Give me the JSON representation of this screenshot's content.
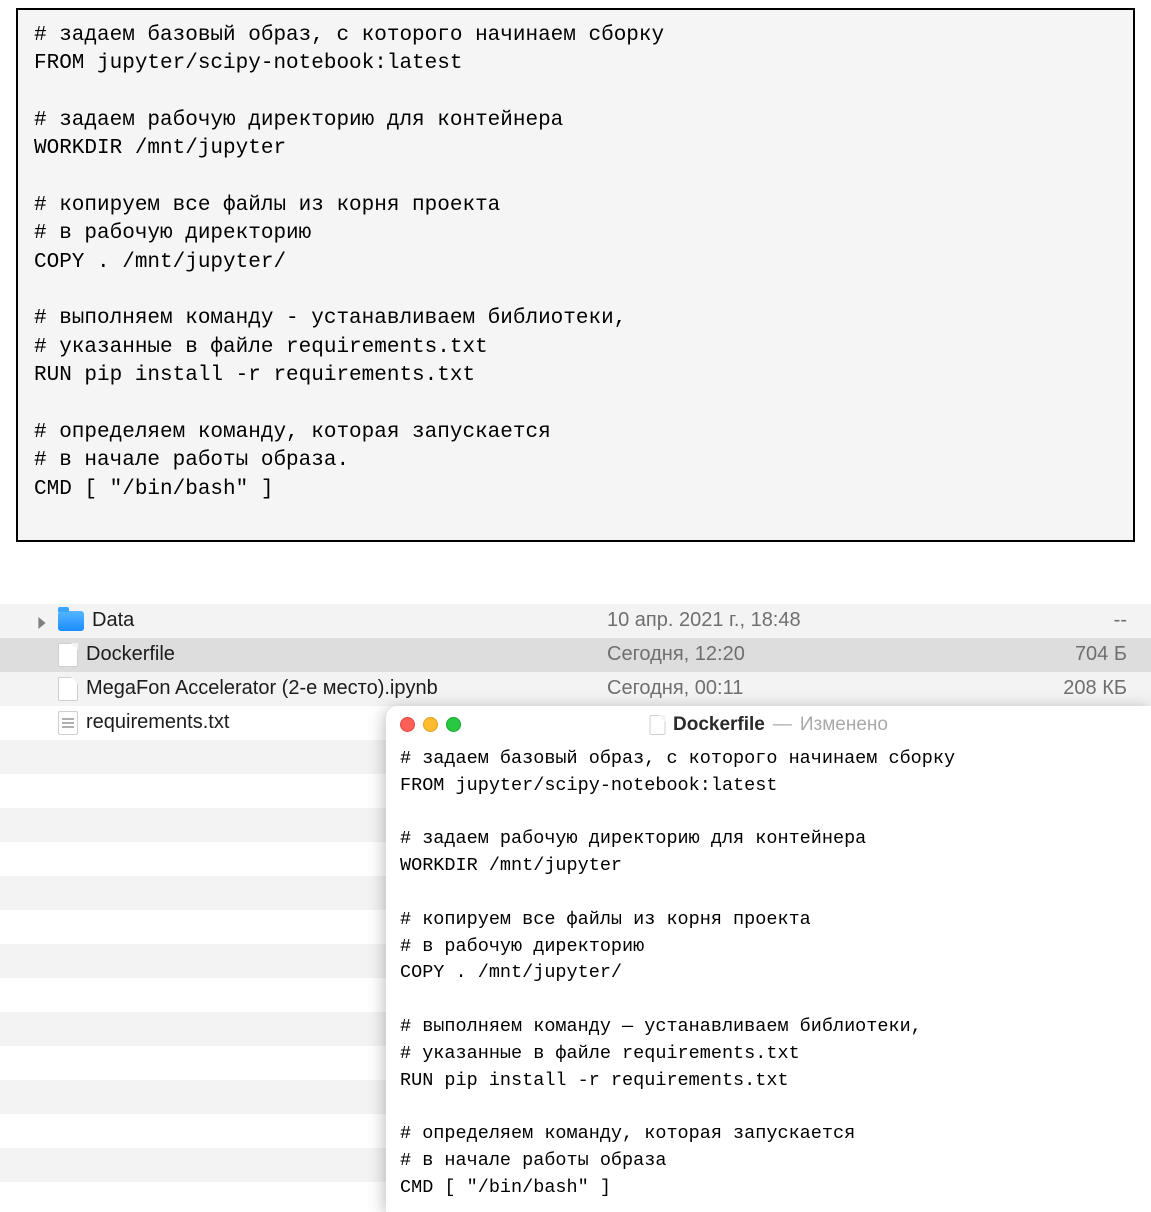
{
  "code_block": {
    "text": "# задаем базовый образ, с которого начинаем сборку\nFROM jupyter/scipy-notebook:latest\n\n# задаем рабочую директорию для контейнера\nWORKDIR /mnt/jupyter\n\n# копируем все файлы из корня проекта\n# в рабочую директорию\nCOPY . /mnt/jupyter/\n\n# выполняем команду - устанавливаем библиотеки,\n# указанные в файле requirements.txt\nRUN pip install -r requirements.txt\n\n# определяем команду, которая запускается\n# в начале работы образа.\nCMD [ \"/bin/bash\" ]"
  },
  "finder": {
    "rows": [
      {
        "kind": "folder",
        "name": "Data",
        "date": "10 апр. 2021 г., 18:48",
        "size": "--",
        "expandable": true
      },
      {
        "kind": "file",
        "name": "Dockerfile",
        "date": "Сегодня, 12:20",
        "size": "704 Б",
        "selected": true
      },
      {
        "kind": "file",
        "name": "MegaFon Accelerator (2-е место).ipynb",
        "date": "Сегодня, 00:11",
        "size": "208 КБ"
      },
      {
        "kind": "txt",
        "name": "requirements.txt",
        "date": "",
        "size": ""
      }
    ]
  },
  "editor": {
    "doc_name": "Dockerfile",
    "dash": "—",
    "status": "Изменено",
    "text": "# задаем базовый образ, с которого начинаем сборку\nFROM jupyter/scipy-notebook:latest\n\n# задаем рабочую директорию для контейнера\nWORKDIR /mnt/jupyter\n\n# копируем все файлы из корня проекта\n# в рабочую директорию\nCOPY . /mnt/jupyter/\n\n# выполняем команду — устанавливаем библиотеки,\n# указанные в файле requirements.txt\nRUN pip install -r requirements.txt\n\n# определяем команду, которая запускается\n# в начале работы образа\nCMD [ \"/bin/bash\" ]"
  }
}
